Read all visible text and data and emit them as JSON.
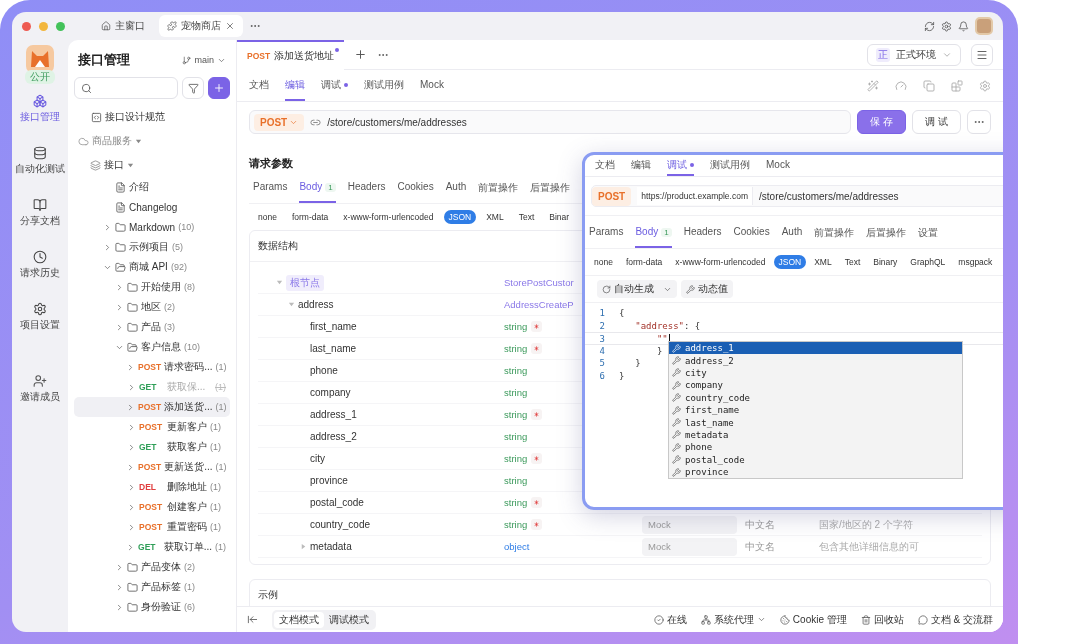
{
  "window_tabs": [
    {
      "label": "主窗口",
      "selected": false
    },
    {
      "label": "宠物商店",
      "selected": true
    }
  ],
  "rail": {
    "badge": "公开",
    "items": [
      {
        "label": "接口管理",
        "selected": true
      },
      {
        "label": "自动化测试",
        "selected": false
      },
      {
        "label": "分享文档",
        "selected": false
      },
      {
        "label": "请求历史",
        "selected": false
      },
      {
        "label": "项目设置",
        "selected": false
      }
    ],
    "invite": "邀请成员"
  },
  "sidebar": {
    "title": "接口管理",
    "branch": "main",
    "tree": [
      {
        "kind": "doc",
        "label": "接口设计规范"
      },
      {
        "kind": "group",
        "label": "商品服务",
        "expanded": true,
        "children": [
          {
            "kind": "group",
            "label": "接口",
            "expanded": true,
            "children": [
              {
                "kind": "doc",
                "label": "介绍"
              },
              {
                "kind": "doc",
                "label": "Changelog"
              },
              {
                "kind": "folder",
                "label": "Markdown",
                "count": "(10)",
                "expanded": false
              },
              {
                "kind": "folder",
                "label": "示例项目",
                "count": "(5)",
                "expanded": false
              },
              {
                "kind": "folder",
                "label": "商城 API",
                "count": "(92)",
                "expanded": true,
                "children": [
                  {
                    "kind": "folder",
                    "label": "开始使用",
                    "count": "(8)",
                    "expanded": false
                  },
                  {
                    "kind": "folder",
                    "label": "地区",
                    "count": "(2)",
                    "expanded": false
                  },
                  {
                    "kind": "folder",
                    "label": "产品",
                    "count": "(3)",
                    "expanded": false
                  },
                  {
                    "kind": "folder",
                    "label": "客户信息",
                    "count": "(10)",
                    "expanded": true,
                    "children": [
                      {
                        "kind": "endpoint",
                        "method": "POST",
                        "label": "请求密码...",
                        "count": "(1)",
                        "selected": false,
                        "deprecated": false
                      },
                      {
                        "kind": "endpoint",
                        "method": "GET",
                        "label": "获取保...",
                        "count": "(1)",
                        "selected": false,
                        "deprecated": true
                      },
                      {
                        "kind": "endpoint",
                        "method": "POST",
                        "label": "添加送货...",
                        "count": "(1)",
                        "selected": true,
                        "deprecated": false
                      },
                      {
                        "kind": "endpoint",
                        "method": "POST",
                        "label": "更新客户",
                        "count": "(1)",
                        "selected": false,
                        "deprecated": false
                      },
                      {
                        "kind": "endpoint",
                        "method": "GET",
                        "label": "获取客户",
                        "count": "(1)",
                        "selected": false,
                        "deprecated": false
                      },
                      {
                        "kind": "endpoint",
                        "method": "POST",
                        "label": "更新送货...",
                        "count": "(1)",
                        "selected": false,
                        "deprecated": false
                      },
                      {
                        "kind": "endpoint",
                        "method": "DEL",
                        "label": "删除地址",
                        "count": "(1)",
                        "selected": false,
                        "deprecated": false
                      },
                      {
                        "kind": "endpoint",
                        "method": "POST",
                        "label": "创建客户",
                        "count": "(1)",
                        "selected": false,
                        "deprecated": false
                      },
                      {
                        "kind": "endpoint",
                        "method": "POST",
                        "label": "重置密码",
                        "count": "(1)",
                        "selected": false,
                        "deprecated": false
                      },
                      {
                        "kind": "endpoint",
                        "method": "GET",
                        "label": "获取订单...",
                        "count": "(1)",
                        "selected": false,
                        "deprecated": false
                      }
                    ]
                  },
                  {
                    "kind": "folder",
                    "label": "产品变体",
                    "count": "(2)",
                    "expanded": false
                  },
                  {
                    "kind": "folder",
                    "label": "产品标签",
                    "count": "(1)",
                    "expanded": false
                  },
                  {
                    "kind": "folder",
                    "label": "身份验证",
                    "count": "(6)",
                    "expanded": false
                  }
                ]
              }
            ]
          }
        ]
      }
    ]
  },
  "request_tabs": [
    {
      "method": "POST",
      "label": "添加送货地址",
      "unsaved": true,
      "selected": true
    }
  ],
  "environment": {
    "badge": "正",
    "label": "正式环境"
  },
  "view_tabs": [
    {
      "label": "文档",
      "selected": false,
      "dot": false
    },
    {
      "label": "编辑",
      "selected": true,
      "dot": false
    },
    {
      "label": "调试",
      "selected": false,
      "dot": true
    },
    {
      "label": "测试用例",
      "selected": false,
      "dot": false
    },
    {
      "label": "Mock",
      "selected": false,
      "dot": false
    }
  ],
  "url_bar": {
    "method": "POST",
    "path": "/store/customers/me/addresses"
  },
  "actions": [
    {
      "label": "保 存",
      "primary": true
    },
    {
      "label": "调 试",
      "primary": false
    }
  ],
  "request_params": {
    "title": "请求参数",
    "tabs": [
      {
        "label": "Params",
        "selected": false
      },
      {
        "label": "Body",
        "count": "1",
        "selected": true
      },
      {
        "label": "Headers",
        "selected": false
      },
      {
        "label": "Cookies",
        "selected": false
      },
      {
        "label": "Auth",
        "selected": false
      },
      {
        "label": "前置操作",
        "selected": false
      },
      {
        "label": "后置操作",
        "selected": false
      }
    ],
    "body_types": [
      {
        "label": "none",
        "selected": false
      },
      {
        "label": "form-data",
        "selected": false
      },
      {
        "label": "x-www-form-urlencoded",
        "selected": false
      },
      {
        "label": "JSON",
        "selected": true
      },
      {
        "label": "XML",
        "selected": false
      },
      {
        "label": "Text",
        "selected": false
      },
      {
        "label": "Binar",
        "selected": false
      }
    ],
    "schema": {
      "title": "数据结构",
      "rows": [
        {
          "kind": "root",
          "name": "根节点",
          "type": "StorePostCustor",
          "expanded": true,
          "children": [
            {
              "kind": "ref",
              "name": "address",
              "type": "AddressCreateP",
              "expanded": true,
              "children": [
                {
                  "kind": "string",
                  "name": "first_name",
                  "type": "string",
                  "required": true
                },
                {
                  "kind": "string",
                  "name": "last_name",
                  "type": "string",
                  "required": true
                },
                {
                  "kind": "string",
                  "name": "phone",
                  "type": "string",
                  "required": false
                },
                {
                  "kind": "string",
                  "name": "company",
                  "type": "string",
                  "required": false
                },
                {
                  "kind": "string",
                  "name": "address_1",
                  "type": "string",
                  "required": true
                },
                {
                  "kind": "string",
                  "name": "address_2",
                  "type": "string",
                  "required": false
                },
                {
                  "kind": "string",
                  "name": "city",
                  "type": "string",
                  "required": true
                },
                {
                  "kind": "string",
                  "name": "province",
                  "type": "string",
                  "required": false
                },
                {
                  "kind": "string",
                  "name": "postal_code",
                  "type": "string",
                  "required": true
                },
                {
                  "kind": "string",
                  "name": "country_code",
                  "type": "string",
                  "required": true,
                  "mock_placeholder": "Mock",
                  "title_placeholder": "中文名",
                  "description": "国家/地区的 2 个字符"
                },
                {
                  "kind": "object",
                  "name": "metadata",
                  "type": "object",
                  "required": false,
                  "expanded": false,
                  "mock_placeholder": "Mock",
                  "title_placeholder": "中文名",
                  "description": "包含其他详细信息的可"
                }
              ]
            }
          ]
        }
      ]
    }
  },
  "example": {
    "title": "示例"
  },
  "status_bar": {
    "modes": [
      {
        "label": "文档模式",
        "selected": true
      },
      {
        "label": "调试模式",
        "selected": false
      }
    ],
    "items": [
      {
        "label": "在线"
      },
      {
        "label": "系统代理"
      },
      {
        "label": "Cookie 管理"
      },
      {
        "label": "回收站"
      },
      {
        "label": "文档 & 交流群"
      }
    ]
  },
  "debug_popup": {
    "tabs": [
      {
        "label": "文档",
        "selected": false,
        "dot": false
      },
      {
        "label": "编辑",
        "selected": false,
        "dot": false
      },
      {
        "label": "调试",
        "selected": true,
        "dot": true
      },
      {
        "label": "测试用例",
        "selected": false,
        "dot": false
      },
      {
        "label": "Mock",
        "selected": false,
        "dot": false
      }
    ],
    "method": "POST",
    "base_url": "https://product.example.com",
    "path": "/store/customers/me/addresses",
    "tabs_2": [
      {
        "label": "Params",
        "selected": false
      },
      {
        "label": "Body",
        "count": "1",
        "selected": true
      },
      {
        "label": "Headers",
        "selected": false
      },
      {
        "label": "Cookies",
        "selected": false
      },
      {
        "label": "Auth",
        "selected": false
      },
      {
        "label": "前置操作",
        "selected": false
      },
      {
        "label": "后置操作",
        "selected": false
      },
      {
        "label": "设置",
        "selected": false
      }
    ],
    "body_types": [
      {
        "label": "none",
        "selected": false
      },
      {
        "label": "form-data",
        "selected": false
      },
      {
        "label": "x-www-form-urlencoded",
        "selected": false
      },
      {
        "label": "JSON",
        "selected": true
      },
      {
        "label": "XML",
        "selected": false
      },
      {
        "label": "Text",
        "selected": false
      },
      {
        "label": "Binary",
        "selected": false
      },
      {
        "label": "GraphQL",
        "selected": false
      },
      {
        "label": "msgpack",
        "selected": false
      }
    ],
    "tools": {
      "generate": "自动生成",
      "dynamic": "动态值"
    },
    "code_lines": [
      {
        "number": "1",
        "cursor": false,
        "tokens": [
          {
            "kind": "punct",
            "text": "{"
          }
        ]
      },
      {
        "number": "2",
        "cursor": false,
        "tokens": [
          {
            "kind": "key",
            "text": "   \"address\""
          },
          {
            "kind": "punct",
            "text": ": {"
          }
        ]
      },
      {
        "number": "3",
        "cursor": true,
        "tokens": [
          {
            "kind": "key",
            "text": "       \"\""
          }
        ]
      },
      {
        "number": "4",
        "cursor": false,
        "tokens": [
          {
            "kind": "punct",
            "text": "       }"
          }
        ]
      },
      {
        "number": "5",
        "cursor": false,
        "tokens": [
          {
            "kind": "punct",
            "text": "   }"
          }
        ]
      },
      {
        "number": "6",
        "cursor": false,
        "tokens": [
          {
            "kind": "punct",
            "text": "}"
          }
        ]
      }
    ],
    "suggestions": [
      {
        "label": "address_1",
        "selected": true
      },
      {
        "label": "address_2",
        "selected": false
      },
      {
        "label": "city",
        "selected": false
      },
      {
        "label": "company",
        "selected": false
      },
      {
        "label": "country_code",
        "selected": false
      },
      {
        "label": "first_name",
        "selected": false
      },
      {
        "label": "last_name",
        "selected": false
      },
      {
        "label": "metadata",
        "selected": false
      },
      {
        "label": "phone",
        "selected": false
      },
      {
        "label": "postal_code",
        "selected": false
      },
      {
        "label": "province",
        "selected": false
      }
    ]
  }
}
